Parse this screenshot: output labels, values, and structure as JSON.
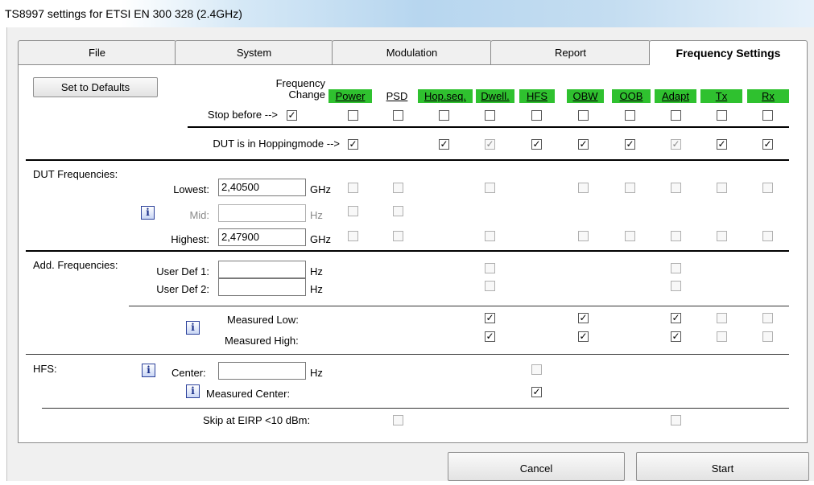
{
  "window": {
    "title": "TS8997 settings for ETSI EN 300 328 (2.4GHz)"
  },
  "tabs": [
    "File",
    "System",
    "Modulation",
    "Report",
    "Frequency Settings"
  ],
  "defaults_button": "Set to Defaults",
  "freq_change_label": "Frequency\nChange",
  "columns": [
    "Power",
    "PSD",
    "Hop.seq.",
    "Dwell.",
    "HFS",
    "OBW",
    "OOB",
    "Adapt",
    "Tx",
    "Rx"
  ],
  "rows": {
    "stop_before": "Stop before -->",
    "hopping": "DUT is in Hoppingmode -->",
    "dut_freq": "DUT Frequencies:",
    "lowest": "Lowest:",
    "lowest_value": "2,40500",
    "lowest_unit": "GHz",
    "mid": "Mid:",
    "mid_value": "",
    "mid_unit": "Hz",
    "highest": "Highest:",
    "highest_value": "2,47900",
    "highest_unit": "GHz",
    "add_freq": "Add. Frequencies:",
    "user1": "User Def 1:",
    "user1_value": "",
    "user1_unit": "Hz",
    "user2": "User Def 2:",
    "user2_value": "",
    "user2_unit": "Hz",
    "meas_low": "Measured Low:",
    "meas_high": "Measured High:",
    "hfs": "HFS:",
    "center": "Center:",
    "center_value": "",
    "center_unit": "Hz",
    "meas_center": "Measured Center:",
    "skip": "Skip at EIRP <10 dBm:"
  },
  "info_glyph": "i",
  "check_glyph": "✓",
  "buttons": {
    "cancel": "Cancel",
    "start": "Start"
  },
  "colors": {
    "column_highlight": "#2fc12f"
  }
}
